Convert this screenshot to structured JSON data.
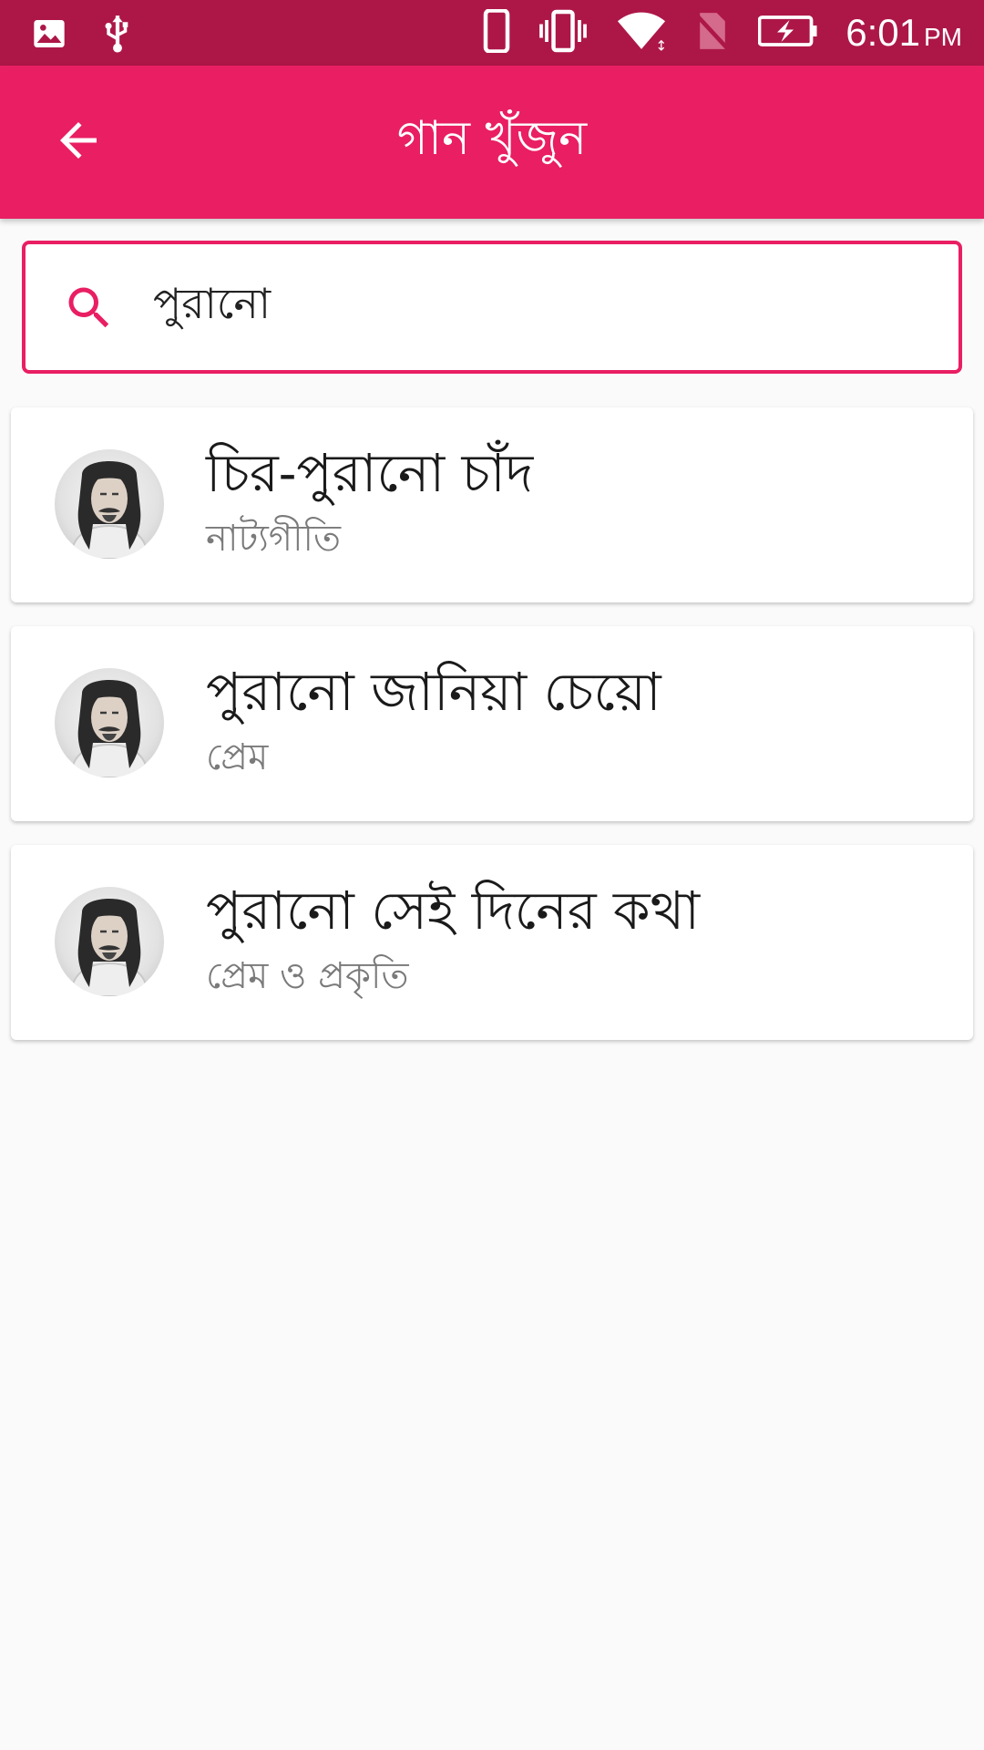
{
  "status_bar": {
    "time": "6:01",
    "ampm": "PM",
    "icons": [
      "image-icon",
      "usb-icon",
      "phone-icon",
      "vibrate-icon",
      "wifi-icon",
      "no-sim-icon",
      "battery-charging-icon"
    ]
  },
  "app_bar": {
    "title": "গান খুঁজুন",
    "back_icon": "arrow-back-icon"
  },
  "search": {
    "value": "পুরানো",
    "icon": "search-icon",
    "accent": "#e91e63"
  },
  "results": [
    {
      "title": "চির-পুরানো চাঁদ",
      "category": "নাট্যগীতি"
    },
    {
      "title": "পুরানো জানিয়া চেয়ো",
      "category": "প্রেম"
    },
    {
      "title": "পুরানো সেই দিনের কথা",
      "category": "প্রেম ও প্রকৃতি"
    }
  ],
  "colors": {
    "status_bar": "#ad1748",
    "app_bar": "#e91e63",
    "background": "#fafafa"
  }
}
